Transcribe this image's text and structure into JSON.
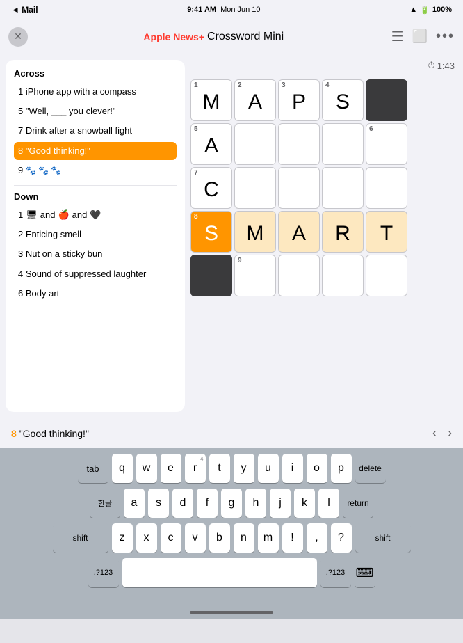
{
  "statusBar": {
    "left": "◄ Mail",
    "time": "9:41 AM",
    "date": "Mon Jun 10",
    "wifi": "WiFi",
    "battery": "100%"
  },
  "header": {
    "title": "Crossword Mini",
    "newsPlus": "News+",
    "appleSymbol": ""
  },
  "timer": {
    "icon": "⏱",
    "value": "1:43"
  },
  "acrossTitle": "Across",
  "downTitle": "Down",
  "cluesAcross": [
    {
      "number": "1",
      "text": "iPhone app with a compass",
      "active": false
    },
    {
      "number": "5",
      "text": "\"Well, ___ you clever!\"",
      "active": false
    },
    {
      "number": "7",
      "text": "Drink after a snowball fight",
      "active": false
    },
    {
      "number": "8",
      "text": "\"Good thinking!\"",
      "active": true
    },
    {
      "number": "9",
      "text": "🐾 🐾 🐾",
      "active": false
    }
  ],
  "cluesDown": [
    {
      "number": "1",
      "text": "🖥 and 🍎 and 🖤",
      "active": false
    },
    {
      "number": "2",
      "text": "Enticing smell",
      "active": false
    },
    {
      "number": "3",
      "text": "Nut on a sticky bun",
      "active": false
    },
    {
      "number": "4",
      "text": "Sound of suppressed laughter",
      "active": false
    },
    {
      "number": "6",
      "text": "Body art",
      "active": false
    }
  ],
  "grid": [
    [
      {
        "number": "1",
        "letter": "M",
        "state": "normal"
      },
      {
        "number": "2",
        "letter": "A",
        "state": "normal"
      },
      {
        "number": "3",
        "letter": "P",
        "state": "normal"
      },
      {
        "number": "4",
        "letter": "S",
        "state": "normal"
      },
      {
        "number": "",
        "letter": "",
        "state": "blocked"
      }
    ],
    [
      {
        "number": "5",
        "letter": "A",
        "state": "normal"
      },
      {
        "number": "",
        "letter": "",
        "state": "normal"
      },
      {
        "number": "",
        "letter": "",
        "state": "normal"
      },
      {
        "number": "",
        "letter": "",
        "state": "normal"
      },
      {
        "number": "6",
        "letter": "",
        "state": "normal"
      }
    ],
    [
      {
        "number": "7",
        "letter": "C",
        "state": "normal"
      },
      {
        "number": "",
        "letter": "",
        "state": "normal"
      },
      {
        "number": "",
        "letter": "",
        "state": "normal"
      },
      {
        "number": "",
        "letter": "",
        "state": "normal"
      },
      {
        "number": "",
        "letter": "",
        "state": "normal"
      }
    ],
    [
      {
        "number": "8",
        "letter": "S",
        "state": "active-letter"
      },
      {
        "number": "",
        "letter": "M",
        "state": "active-word"
      },
      {
        "number": "",
        "letter": "A",
        "state": "active-word"
      },
      {
        "number": "",
        "letter": "R",
        "state": "active-word"
      },
      {
        "number": "",
        "letter": "T",
        "state": "active-word"
      }
    ],
    [
      {
        "number": "",
        "letter": "",
        "state": "blocked"
      },
      {
        "number": "9",
        "letter": "",
        "state": "normal"
      },
      {
        "number": "",
        "letter": "",
        "state": "normal"
      },
      {
        "number": "",
        "letter": "",
        "state": "normal"
      },
      {
        "number": "",
        "letter": "",
        "state": "normal"
      }
    ]
  ],
  "currentClue": {
    "number": "8",
    "emoji": "🟠",
    "text": "\"Good thinking!\""
  },
  "keyboard": {
    "row1": [
      "q",
      "w",
      "e",
      "r",
      "t",
      "y",
      "u",
      "i",
      "o",
      "p"
    ],
    "row1subs": [
      "",
      "",
      "",
      "",
      "",
      "",
      "",
      "",
      "",
      ""
    ],
    "row2": [
      "a",
      "s",
      "d",
      "f",
      "g",
      "h",
      "j",
      "k",
      "l"
    ],
    "row3": [
      "z",
      "x",
      "c",
      "v",
      "b",
      "n",
      "m",
      "!",
      ",",
      "?"
    ],
    "specialLeft": "shift",
    "specialRight": "shift",
    "bottomLeft": ".?123",
    "bottomRight": ".?123",
    "deleteKey": "delete",
    "returnKey": "return",
    "spaceKey": "",
    "langKey": "한글",
    "tabKey": "tab"
  }
}
